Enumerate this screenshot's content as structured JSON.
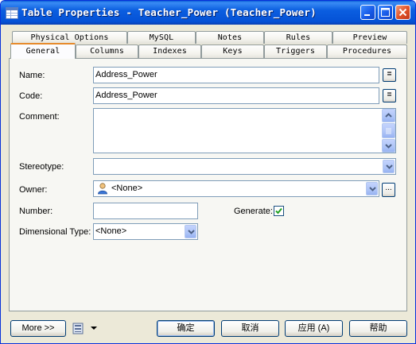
{
  "window": {
    "title": "Table Properties - Teacher_Power (Teacher_Power)"
  },
  "tabs": {
    "back_row": [
      "Physical Options",
      "MySQL",
      "Notes",
      "Rules",
      "Preview"
    ],
    "front_row": [
      "General",
      "Columns",
      "Indexes",
      "Keys",
      "Triggers",
      "Procedures"
    ],
    "active": "General"
  },
  "form": {
    "name_label": "Name:",
    "name_value": "Address_Power",
    "code_label": "Code:",
    "code_value": "Address_Power",
    "equal_button": "=",
    "comment_label": "Comment:",
    "comment_value": "",
    "stereotype_label": "Stereotype:",
    "stereotype_value": "",
    "owner_label": "Owner:",
    "owner_value": "<None>",
    "ellipsis_button": "...",
    "number_label": "Number:",
    "number_value": "",
    "generate_label": "Generate:",
    "generate_checked": true,
    "dimensional_label": "Dimensional Type:",
    "dimensional_value": "<None>"
  },
  "footer": {
    "more_button": "More >>",
    "ok_button": "确定",
    "cancel_button": "取消",
    "apply_button": "应用 (A)",
    "help_button": "帮助"
  },
  "colors": {
    "title_bar": "#0552d6",
    "active_tab_accent": "#e68b2c",
    "checkmark": "#21a121"
  }
}
